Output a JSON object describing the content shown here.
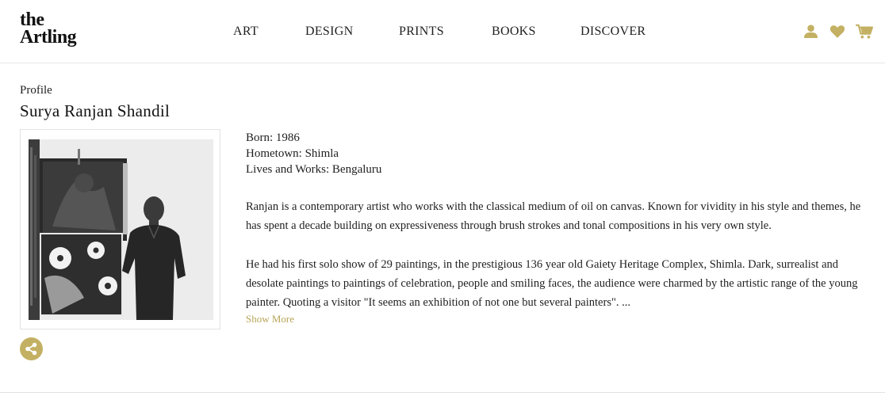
{
  "logo": {
    "line1": "the",
    "line2": "Artling"
  },
  "nav": {
    "items": [
      "ART",
      "DESIGN",
      "PRINTS",
      "BOOKS",
      "DISCOVER"
    ]
  },
  "header_icons": {
    "user": "user-icon",
    "wishlist": "heart-icon",
    "cart": "cart-icon"
  },
  "profile": {
    "label": "Profile",
    "name": "Surya Ranjan Shandil",
    "born": "Born: 1986",
    "hometown": "Hometown: Shimla",
    "lives_works": "Lives and Works: Bengaluru",
    "bio_1": "Ranjan is a contemporary artist who works with the classical medium of oil on canvas. Known for vividity in his style and themes, he has spent a decade building on expressiveness through brush strokes and tonal compositions in his very own style.",
    "bio_2": "He had his first solo show of 29 paintings, in the prestigious 136 year old Gaiety Heritage Complex, Shimla. Dark, surrealist and desolate paintings to paintings of celebration, people and smiling faces, the audience were charmed by the artistic range of the young painter. Quoting a visitor \"It seems an exhibition of not one but several painters\". ...",
    "show_more": "Show More",
    "share_icon": "share-icon"
  },
  "colors": {
    "accent": "#c3b062",
    "link": "#b8a558",
    "text": "#1f1f1f",
    "border": "#e3e3e3"
  }
}
